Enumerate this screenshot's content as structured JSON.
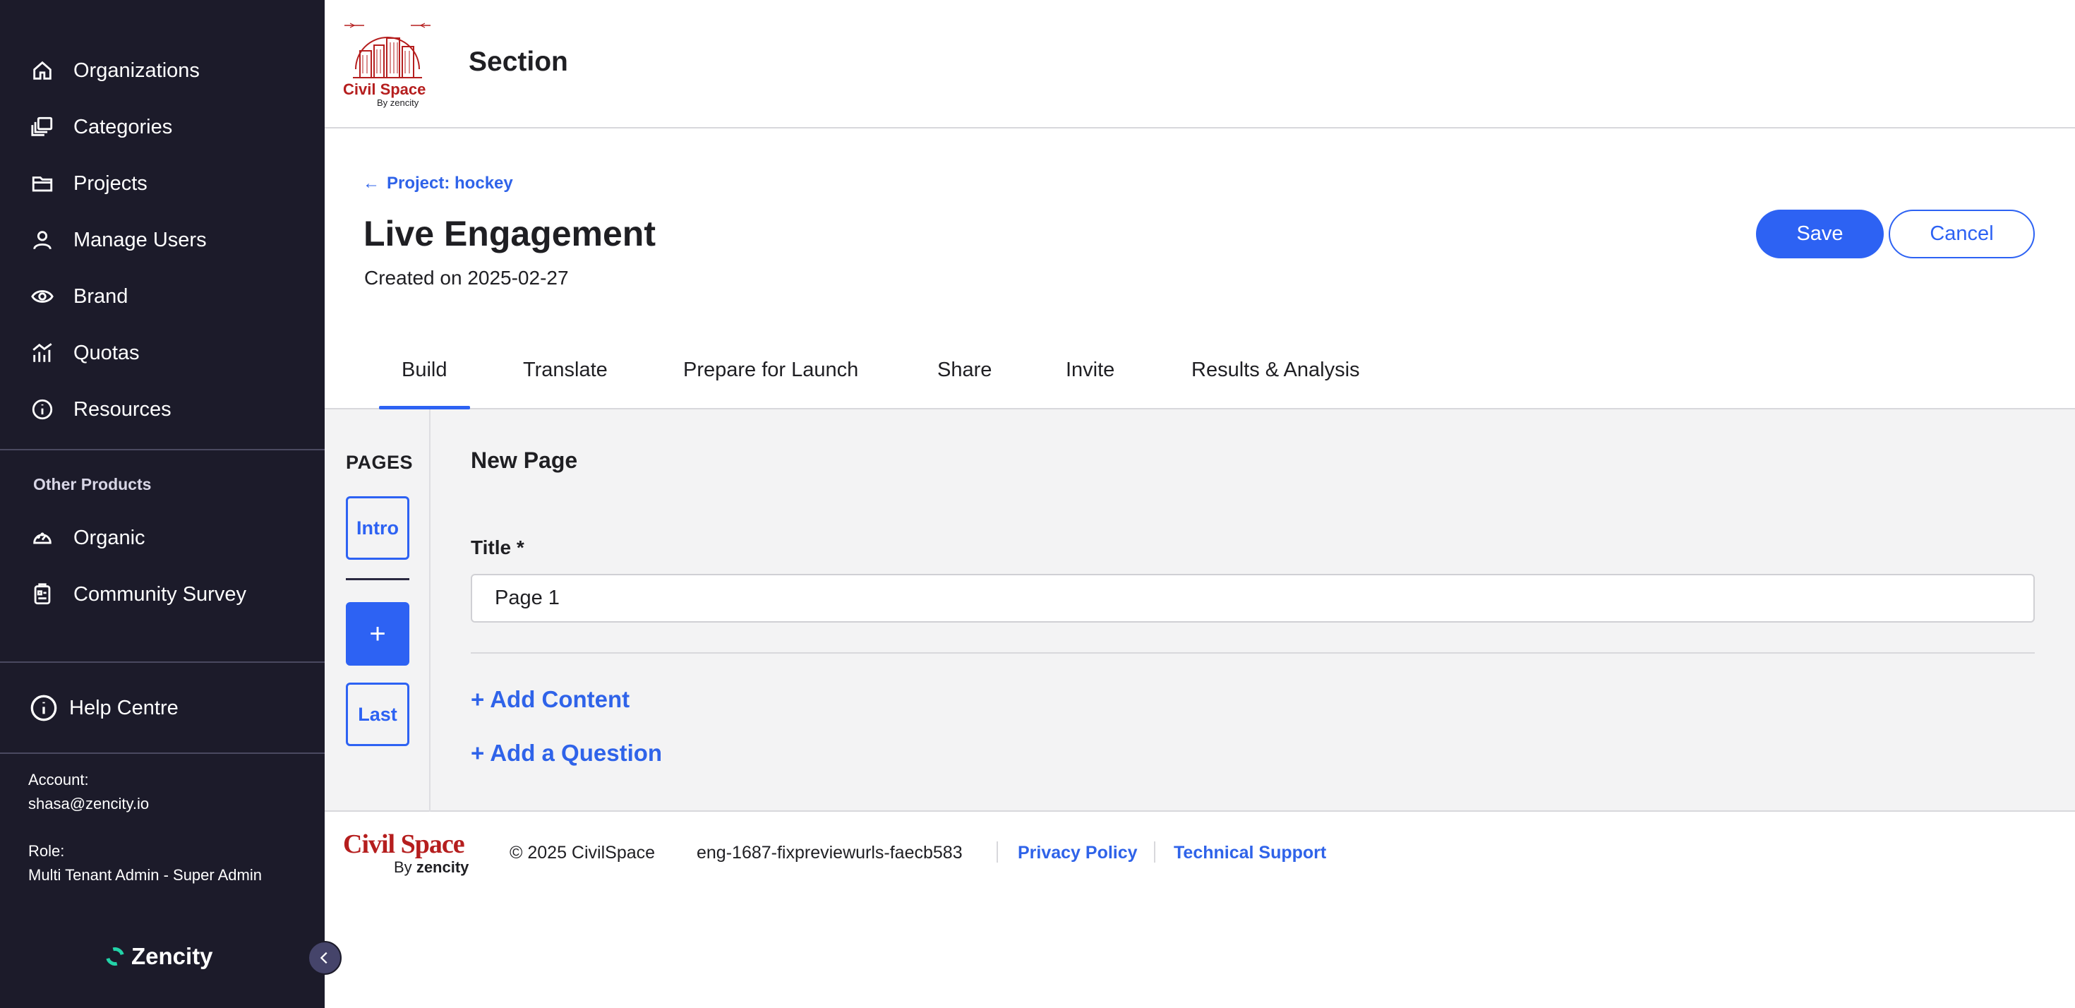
{
  "sidebar": {
    "items": [
      {
        "label": "Organizations",
        "icon": "home-icon"
      },
      {
        "label": "Categories",
        "icon": "stacked-cards-icon"
      },
      {
        "label": "Projects",
        "icon": "folder-icon"
      },
      {
        "label": "Manage Users",
        "icon": "user-icon"
      },
      {
        "label": "Brand",
        "icon": "eye-icon"
      },
      {
        "label": "Quotas",
        "icon": "chart-icon"
      },
      {
        "label": "Resources",
        "icon": "info-icon"
      }
    ],
    "other_products_label": "Other Products",
    "other_items": [
      {
        "label": "Organic",
        "icon": "gauge-icon"
      },
      {
        "label": "Community Survey",
        "icon": "clipboard-icon"
      }
    ],
    "help_label": "Help Centre",
    "account_label": "Account:",
    "account_value": "shasa@zencity.io",
    "role_label": "Role:",
    "role_value": "Multi Tenant Admin - Super Admin",
    "brand_name": "Zencity"
  },
  "header": {
    "section_title": "Section",
    "logo_text": "Civil Space",
    "logo_by": "By zencity"
  },
  "page": {
    "back_link": "Project: hockey",
    "title": "Live Engagement",
    "created": "Created on 2025-02-27",
    "save_label": "Save",
    "cancel_label": "Cancel"
  },
  "tabs": [
    "Build",
    "Translate",
    "Prepare for Launch",
    "Share",
    "Invite",
    "Results & Analysis"
  ],
  "active_tab": "Build",
  "pages_panel": {
    "label": "PAGES",
    "intro_label": "Intro",
    "add_label": "+",
    "last_label": "Last"
  },
  "editor": {
    "heading": "New Page",
    "title_label": "Title *",
    "title_value": "Page 1",
    "add_content": "+ Add Content",
    "add_question": "+ Add a Question"
  },
  "footer": {
    "logo_text": "Civil Space",
    "logo_by": "By",
    "logo_brand": "zencity",
    "copyright": "© 2025 CivilSpace",
    "build": "eng-1687-fixpreviewurls-faecb583",
    "privacy": "Privacy Policy",
    "support": "Technical Support"
  },
  "colors": {
    "sidebar_bg": "#1c1b2a",
    "accent": "#2d62f3",
    "brand_red": "#b51e1e",
    "build_bg": "#f3f3f4"
  }
}
